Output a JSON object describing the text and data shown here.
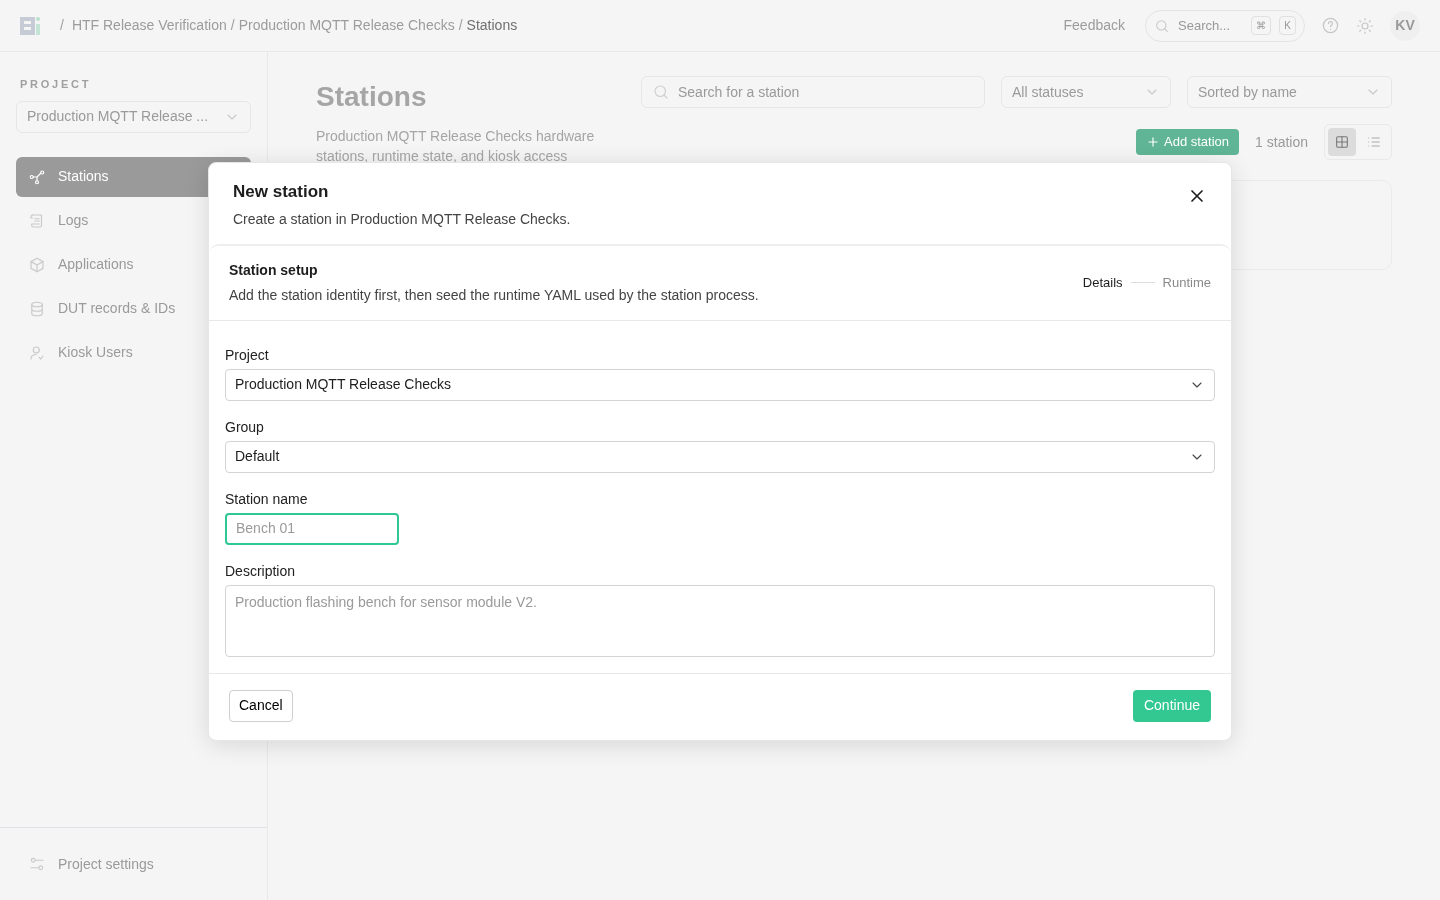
{
  "topbar": {
    "separator": "/",
    "breadcrumbs": [
      {
        "label": "HTF Release Verification",
        "current": false
      },
      {
        "label": "Production MQTT Release Checks",
        "current": false
      },
      {
        "label": "Stations",
        "current": true
      }
    ],
    "feedback": "Feedback",
    "search": {
      "placeholder": "Search...",
      "keys": [
        "⌘",
        "K"
      ]
    },
    "avatar": "KV"
  },
  "sidebar": {
    "section_label": "PROJECT",
    "project_select": "Production MQTT Release ...",
    "items": [
      {
        "label": "Stations",
        "selected": true
      },
      {
        "label": "Logs",
        "selected": false
      },
      {
        "label": "Applications",
        "selected": false
      },
      {
        "label": "DUT records & IDs",
        "selected": false
      },
      {
        "label": "Kiosk Users",
        "selected": false
      }
    ],
    "footer_item": {
      "label": "Project settings"
    }
  },
  "page": {
    "title": "Stations",
    "description": "Production MQTT Release Checks hardware stations, runtime state, and kiosk access",
    "search": {
      "placeholder": "Search for a station"
    },
    "status_filter": "All statuses",
    "sort": "Sorted by name",
    "add_button": "Add station",
    "count": "1 station",
    "views": [
      {
        "kind": "grid",
        "selected": true
      },
      {
        "kind": "list",
        "selected": false
      }
    ]
  },
  "modal": {
    "title": "New station",
    "subtitle": "Create a station in Production MQTT Release Checks.",
    "section": {
      "title": "Station setup",
      "description": "Add the station identity first, then seed the runtime YAML used by the station process."
    },
    "steps": [
      {
        "label": "Details",
        "selected": true
      },
      {
        "label": "Runtime",
        "selected": false
      }
    ],
    "fields": [
      {
        "kind": "select",
        "label": "Project",
        "value": "Production MQTT Release Checks"
      },
      {
        "kind": "select",
        "label": "Group",
        "value": "Default"
      },
      {
        "kind": "input",
        "label": "Station name",
        "placeholder": "Bench 01",
        "focused": true
      },
      {
        "kind": "textarea",
        "label": "Description",
        "placeholder": "Production flashing bench for sensor module V2."
      }
    ],
    "cancel": "Cancel",
    "submit": "Continue"
  }
}
